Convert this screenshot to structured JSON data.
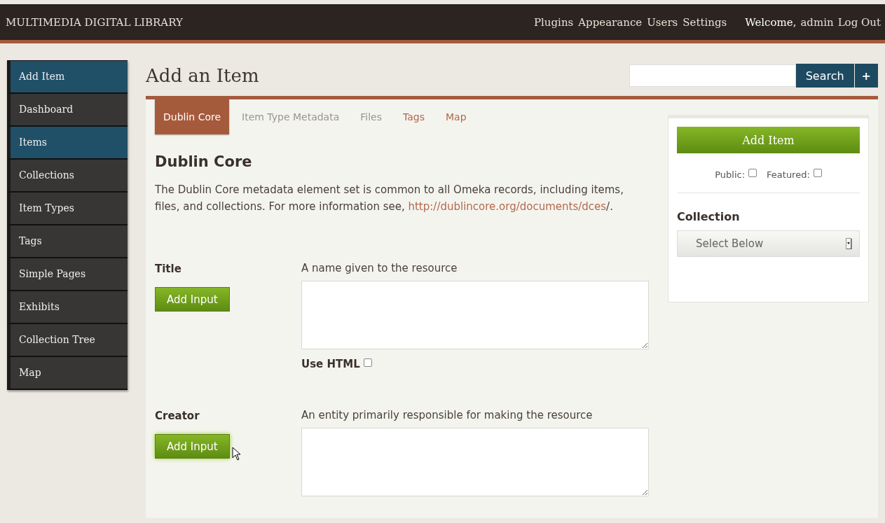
{
  "header": {
    "title": "MULTIMEDIA DIGITAL LIBRARY",
    "nav": [
      "Plugins",
      "Appearance",
      "Users",
      "Settings"
    ],
    "welcome": "Welcome,",
    "user": "admin",
    "logout": "Log Out"
  },
  "sidebar": {
    "items": [
      {
        "label": "Add Item",
        "selected": true
      },
      {
        "label": "Dashboard",
        "selected": false
      },
      {
        "label": "Items",
        "selected": true
      },
      {
        "label": "Collections",
        "selected": false
      },
      {
        "label": "Item Types",
        "selected": false
      },
      {
        "label": "Tags",
        "selected": false
      },
      {
        "label": "Simple Pages",
        "selected": false
      },
      {
        "label": "Exhibits",
        "selected": false
      },
      {
        "label": "Collection Tree",
        "selected": false
      },
      {
        "label": "Map",
        "selected": false
      }
    ]
  },
  "page_title": "Add an Item",
  "search": {
    "button": "Search",
    "add": "+"
  },
  "tabs": [
    {
      "label": "Dublin Core",
      "selected": true,
      "kind": "core"
    },
    {
      "label": "Item Type Metadata",
      "selected": false,
      "kind": "core"
    },
    {
      "label": "Files",
      "selected": false,
      "kind": "core"
    },
    {
      "label": "Tags",
      "selected": false,
      "kind": "plugin"
    },
    {
      "label": "Map",
      "selected": false,
      "kind": "plugin"
    }
  ],
  "section": {
    "heading": "Dublin Core",
    "description": "The Dublin Core metadata element set is common to all Omeka records, including items, files, and collections. For more information see,",
    "link": "http://dublincore.org/documents/dces",
    "after_link": "/."
  },
  "fields": [
    {
      "label": "Title",
      "button": "Add Input",
      "hint": "A name given to the resource",
      "use_html": {
        "label": "Use HTML",
        "checked": false
      }
    },
    {
      "label": "Creator",
      "button": "Add Input",
      "hint": "An entity primarily responsible for making the resource",
      "hovered": true
    }
  ],
  "panel": {
    "button": "Add Item",
    "public": {
      "label": "Public:",
      "checked": false
    },
    "featured": {
      "label": "Featured:",
      "checked": false
    },
    "collection_label": "Collection",
    "select": "Select Below"
  }
}
